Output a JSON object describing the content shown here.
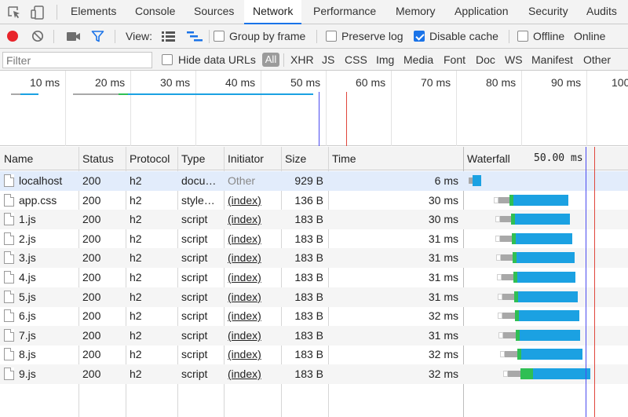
{
  "tabs": {
    "elements": "Elements",
    "console": "Console",
    "sources": "Sources",
    "network": "Network",
    "performance": "Performance",
    "memory": "Memory",
    "application": "Application",
    "security": "Security",
    "audits": "Audits"
  },
  "toolbar": {
    "view_label": "View:",
    "group_by_frame": "Group by frame",
    "preserve_log": "Preserve log",
    "disable_cache": "Disable cache",
    "offline": "Offline",
    "online": "Online",
    "group_by_frame_checked": false,
    "preserve_log_checked": false,
    "disable_cache_checked": true,
    "offline_checked": false
  },
  "filter": {
    "placeholder": "Filter",
    "hide_data_urls": "Hide data URLs",
    "types": {
      "all": "All",
      "xhr": "XHR",
      "js": "JS",
      "css": "CSS",
      "img": "Img",
      "media": "Media",
      "font": "Font",
      "doc": "Doc",
      "ws": "WS",
      "manifest": "Manifest",
      "other": "Other"
    }
  },
  "overview": {
    "ticks": [
      "10 ms",
      "20 ms",
      "30 ms",
      "40 ms",
      "50 ms",
      "60 ms",
      "70 ms",
      "80 ms",
      "90 ms",
      "100"
    ]
  },
  "columns": {
    "name": "Name",
    "status": "Status",
    "protocol": "Protocol",
    "type": "Type",
    "initiator": "Initiator",
    "size": "Size",
    "time": "Time",
    "waterfall": "Waterfall",
    "waterfall_scale": "50.00 ms"
  },
  "rows": [
    {
      "name": "localhost",
      "status": "200",
      "protocol": "h2",
      "type": "docu…",
      "initiator": "Other",
      "size": "929 B",
      "time": "6 ms"
    },
    {
      "name": "app.css",
      "status": "200",
      "protocol": "h2",
      "type": "style…",
      "initiator": "(index)",
      "size": "136 B",
      "time": "30 ms"
    },
    {
      "name": "1.js",
      "status": "200",
      "protocol": "h2",
      "type": "script",
      "initiator": "(index)",
      "size": "183 B",
      "time": "30 ms"
    },
    {
      "name": "2.js",
      "status": "200",
      "protocol": "h2",
      "type": "script",
      "initiator": "(index)",
      "size": "183 B",
      "time": "31 ms"
    },
    {
      "name": "3.js",
      "status": "200",
      "protocol": "h2",
      "type": "script",
      "initiator": "(index)",
      "size": "183 B",
      "time": "31 ms"
    },
    {
      "name": "4.js",
      "status": "200",
      "protocol": "h2",
      "type": "script",
      "initiator": "(index)",
      "size": "183 B",
      "time": "31 ms"
    },
    {
      "name": "5.js",
      "status": "200",
      "protocol": "h2",
      "type": "script",
      "initiator": "(index)",
      "size": "183 B",
      "time": "31 ms"
    },
    {
      "name": "6.js",
      "status": "200",
      "protocol": "h2",
      "type": "script",
      "initiator": "(index)",
      "size": "183 B",
      "time": "32 ms"
    },
    {
      "name": "7.js",
      "status": "200",
      "protocol": "h2",
      "type": "script",
      "initiator": "(index)",
      "size": "183 B",
      "time": "31 ms"
    },
    {
      "name": "8.js",
      "status": "200",
      "protocol": "h2",
      "type": "script",
      "initiator": "(index)",
      "size": "183 B",
      "time": "32 ms"
    },
    {
      "name": "9.js",
      "status": "200",
      "protocol": "h2",
      "type": "script",
      "initiator": "(index)",
      "size": "183 B",
      "time": "32 ms"
    }
  ],
  "colors": {
    "record": "#e8242b",
    "accent": "#1a73e8",
    "waiting": "#2fbf54",
    "download": "#1ba1e2",
    "stalled": "#a8a8a8",
    "dom_content_loaded": "#4a4af0",
    "load": "#e0463c"
  }
}
